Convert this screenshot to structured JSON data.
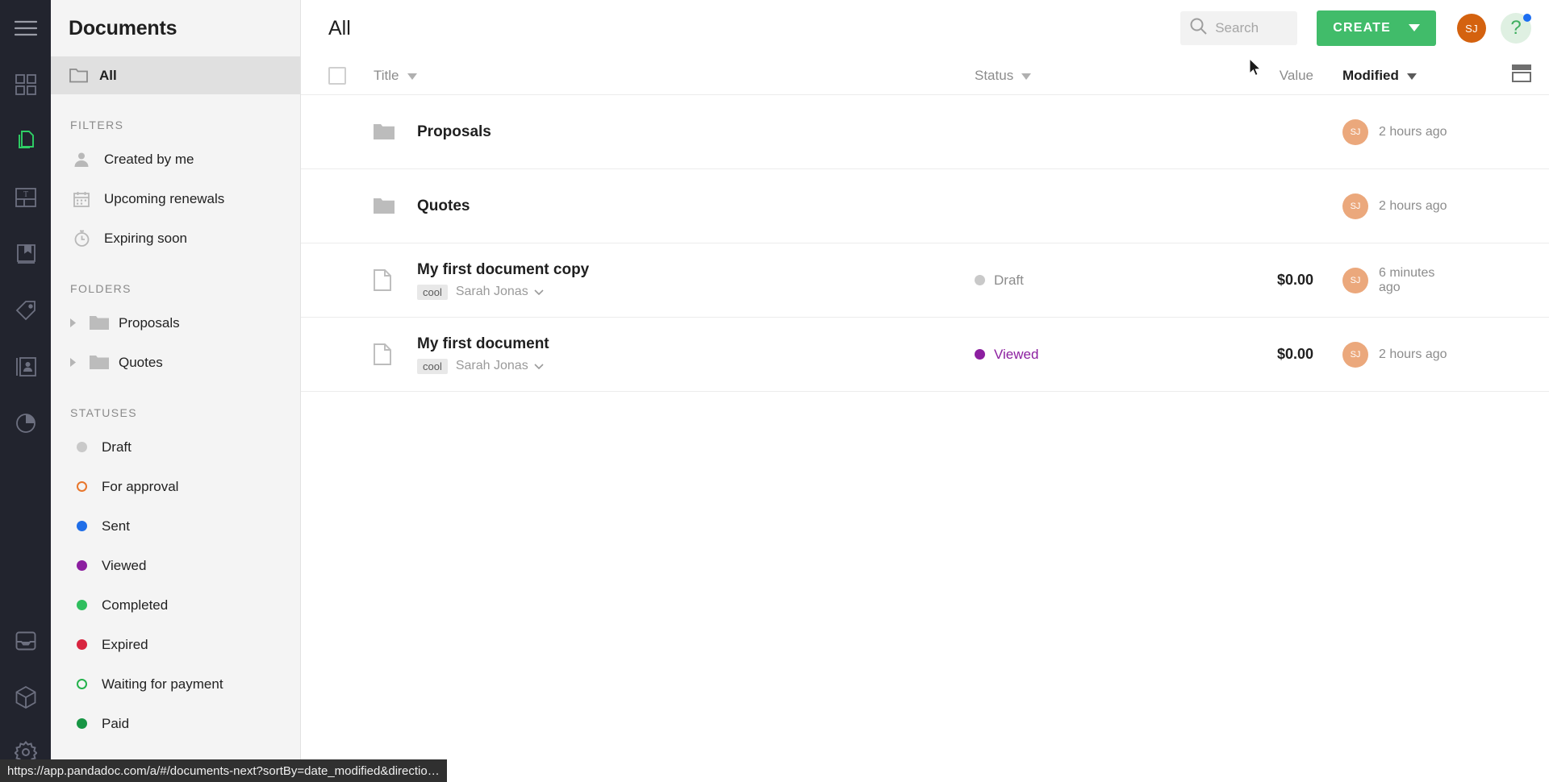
{
  "colors": {
    "rail_bg": "#22242e",
    "sidebar_bg": "#f4f4f4",
    "accent_green": "#41bc6a",
    "avatar_top": "#d4620f",
    "avatar_row": "#eba87c",
    "help_bg": "#dff0e2",
    "badge_blue": "#1c6ef2",
    "status_draft": "#c9c9c9",
    "status_for_approval": "#e8762c",
    "status_sent": "#1f6ee8",
    "status_viewed": "#8c1fa0",
    "status_completed": "#2fbe5e",
    "status_expired": "#d8253f",
    "status_waiting": "#24b24c",
    "status_paid": "#179544"
  },
  "rail": {
    "items": [
      {
        "name": "menu-icon",
        "label": "Menu",
        "active": false
      },
      {
        "name": "dashboard-icon",
        "label": "Dashboard",
        "active": false
      },
      {
        "name": "documents-icon",
        "label": "Documents",
        "active": true
      },
      {
        "name": "templates-icon",
        "label": "Templates",
        "active": false
      },
      {
        "name": "content-library-icon",
        "label": "Content library",
        "active": false
      },
      {
        "name": "catalog-tag-icon",
        "label": "Catalog",
        "active": false
      },
      {
        "name": "contacts-icon",
        "label": "Contacts",
        "active": false
      },
      {
        "name": "reports-icon",
        "label": "Reports",
        "active": false
      }
    ],
    "bottom_items": [
      {
        "name": "inbox-icon",
        "label": "Inbox"
      },
      {
        "name": "integrations-icon",
        "label": "Integrations"
      },
      {
        "name": "settings-gear-icon",
        "label": "Settings"
      }
    ]
  },
  "sidebar": {
    "title": "Documents",
    "all_label": "All",
    "filters_heading": "FILTERS",
    "filters": [
      {
        "label": "Created by me",
        "icon": "person-icon"
      },
      {
        "label": "Upcoming renewals",
        "icon": "calendar-icon"
      },
      {
        "label": "Expiring soon",
        "icon": "clock-icon"
      }
    ],
    "folders_heading": "FOLDERS",
    "folders": [
      {
        "label": "Proposals"
      },
      {
        "label": "Quotes"
      }
    ],
    "statuses_heading": "STATUSES",
    "statuses": [
      {
        "label": "Draft",
        "color": "#c9c9c9",
        "ring": false
      },
      {
        "label": "For approval",
        "color": "#e8762c",
        "ring": true
      },
      {
        "label": "Sent",
        "color": "#1f6ee8",
        "ring": false
      },
      {
        "label": "Viewed",
        "color": "#8c1fa0",
        "ring": false
      },
      {
        "label": "Completed",
        "color": "#2fbe5e",
        "ring": false
      },
      {
        "label": "Expired",
        "color": "#d8253f",
        "ring": false
      },
      {
        "label": "Waiting for payment",
        "color": "#24b24c",
        "ring": true
      },
      {
        "label": "Paid",
        "color": "#179544",
        "ring": false
      }
    ]
  },
  "header": {
    "page_title": "All",
    "search_placeholder": "Search",
    "search_value": "",
    "create_label": "CREATE",
    "avatar_initials": "SJ",
    "help_glyph": "?"
  },
  "table": {
    "columns": {
      "title": "Title",
      "status": "Status",
      "value": "Value",
      "modified": "Modified"
    },
    "sorted_by": "Modified",
    "rows": [
      {
        "type": "folder",
        "name": "Proposals",
        "tag": "",
        "owner": "",
        "status": "",
        "status_color": "",
        "value": "",
        "avatar": "SJ",
        "modified": "2 hours ago"
      },
      {
        "type": "folder",
        "name": "Quotes",
        "tag": "",
        "owner": "",
        "status": "",
        "status_color": "",
        "value": "",
        "avatar": "SJ",
        "modified": "2 hours ago"
      },
      {
        "type": "document",
        "name": "My first document copy",
        "tag": "cool",
        "owner": "Sarah Jonas",
        "status": "Draft",
        "status_color": "#c9c9c9",
        "status_text_color": "#8c8c8c",
        "value": "$0.00",
        "avatar": "SJ",
        "modified": "6 minutes ago"
      },
      {
        "type": "document",
        "name": "My first document",
        "tag": "cool",
        "owner": "Sarah Jonas",
        "status": "Viewed",
        "status_color": "#8c1fa0",
        "status_text_color": "#8c1fa0",
        "value": "$0.00",
        "avatar": "SJ",
        "modified": "2 hours ago"
      }
    ]
  },
  "statusbar": {
    "url": "https://app.pandadoc.com/a/#/documents-next?sortBy=date_modified&directio…"
  }
}
